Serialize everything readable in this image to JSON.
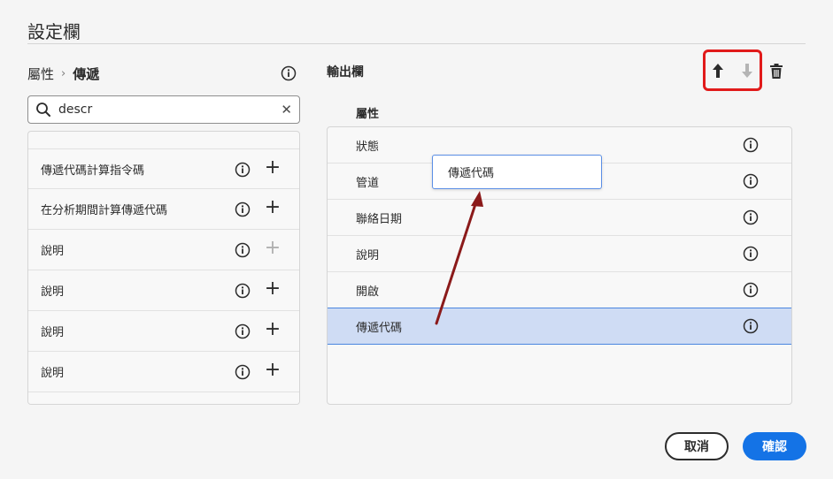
{
  "dialog": {
    "title": "設定欄"
  },
  "left": {
    "breadcrumb": {
      "parent": "屬性",
      "current": "傳遞"
    },
    "search": {
      "value": "descr",
      "placeholder": ""
    },
    "items": [
      {
        "label": "傳遞代碼計算指令碼",
        "addable": true
      },
      {
        "label": "在分析期間計算傳遞代碼",
        "addable": true
      },
      {
        "label": "說明",
        "addable": false
      },
      {
        "label": "說明",
        "addable": true
      },
      {
        "label": "說明",
        "addable": true
      },
      {
        "label": "說明",
        "addable": true
      }
    ]
  },
  "right": {
    "title": "輸出欄",
    "column_header": "屬性",
    "items": [
      {
        "label": "狀態",
        "selected": false
      },
      {
        "label": "管道",
        "selected": false
      },
      {
        "label": "聯絡日期",
        "selected": false
      },
      {
        "label": "說明",
        "selected": false
      },
      {
        "label": "開啟",
        "selected": false
      },
      {
        "label": "傳遞代碼",
        "selected": true
      }
    ],
    "drag_preview": "傳遞代碼"
  },
  "footer": {
    "cancel_label": "取消",
    "confirm_label": "確認"
  },
  "colors": {
    "accent": "#1473e6",
    "highlight_box": "#e11a1a",
    "selected_row": "#cfdcf4",
    "annotation_arrow": "#8b1a1a"
  },
  "icons": [
    "search-icon",
    "info-icon",
    "plus-icon",
    "arrow-up-icon",
    "arrow-down-icon",
    "trash-icon",
    "clear-icon",
    "chevron-right-icon"
  ]
}
